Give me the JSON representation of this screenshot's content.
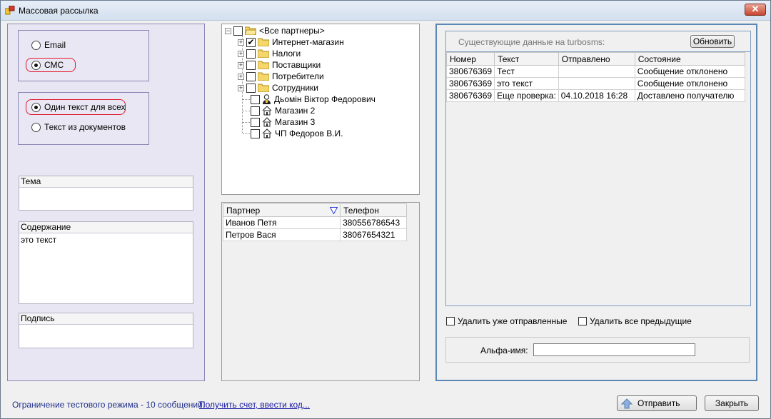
{
  "window": {
    "title": "Массовая рассылка",
    "close_label": "✕"
  },
  "send_mode": {
    "options": [
      {
        "label": "Email",
        "selected": false
      },
      {
        "label": "СМС",
        "selected": true
      }
    ]
  },
  "text_mode": {
    "options": [
      {
        "label": "Один текст для всех",
        "selected": true
      },
      {
        "label": "Текст из документов",
        "selected": false
      }
    ]
  },
  "fields": {
    "subject": {
      "label": "Тема",
      "value": ""
    },
    "content": {
      "label": "Содержание",
      "value": "это текст"
    },
    "signature": {
      "label": "Подпись",
      "value": ""
    }
  },
  "tree": {
    "root": "<Все партнеры>",
    "nodes": [
      {
        "label": "Интернет-магазин",
        "checked": true,
        "type": "folder"
      },
      {
        "label": "Налоги",
        "checked": false,
        "type": "folder"
      },
      {
        "label": "Поставщики",
        "checked": false,
        "type": "folder"
      },
      {
        "label": "Потребители",
        "checked": false,
        "type": "folder"
      },
      {
        "label": "Сотрудники",
        "checked": false,
        "type": "folder"
      },
      {
        "label": "Дьомін Віктор Федорович",
        "checked": false,
        "type": "person"
      },
      {
        "label": "Магазин 2",
        "checked": false,
        "type": "house"
      },
      {
        "label": "Магазин 3",
        "checked": false,
        "type": "house"
      },
      {
        "label": "ЧП Федоров В.И.",
        "checked": false,
        "type": "house"
      }
    ]
  },
  "partners_grid": {
    "columns": [
      "Партнер",
      "Телефон"
    ],
    "rows": [
      [
        "Иванов Петя",
        "380556786543"
      ],
      [
        "Петров Вася",
        "38067654321"
      ]
    ]
  },
  "turbosms": {
    "caption": "Существующие данные на turbosms:",
    "refresh_label": "Обновить",
    "columns": [
      "Номер",
      "Текст",
      "Отправлено",
      "Состояние"
    ],
    "rows": [
      [
        "380676369",
        "Тест",
        "",
        "Сообщение отклонено"
      ],
      [
        "380676369",
        "это текст",
        "",
        "Сообщение отклонено"
      ],
      [
        "380676369",
        "Еще проверка:",
        "04.10.2018 16:28",
        "Доставлено получателю"
      ]
    ],
    "delete_sent_label": "Удалить уже отправленные",
    "delete_all_label": "Удалить все предыдущие",
    "alpha_label": "Альфа-имя:",
    "alpha_value": ""
  },
  "footer": {
    "status": "Ограничение тестового режима - 10 сообщений.",
    "link": "Получить счет, ввести код...",
    "send_label": "Отправить",
    "close_label": "Закрыть"
  },
  "colors": {
    "accent_border": "#5b87b4",
    "lilac_panel": "#e8e6f2",
    "highlight_red": "#e0182d"
  }
}
